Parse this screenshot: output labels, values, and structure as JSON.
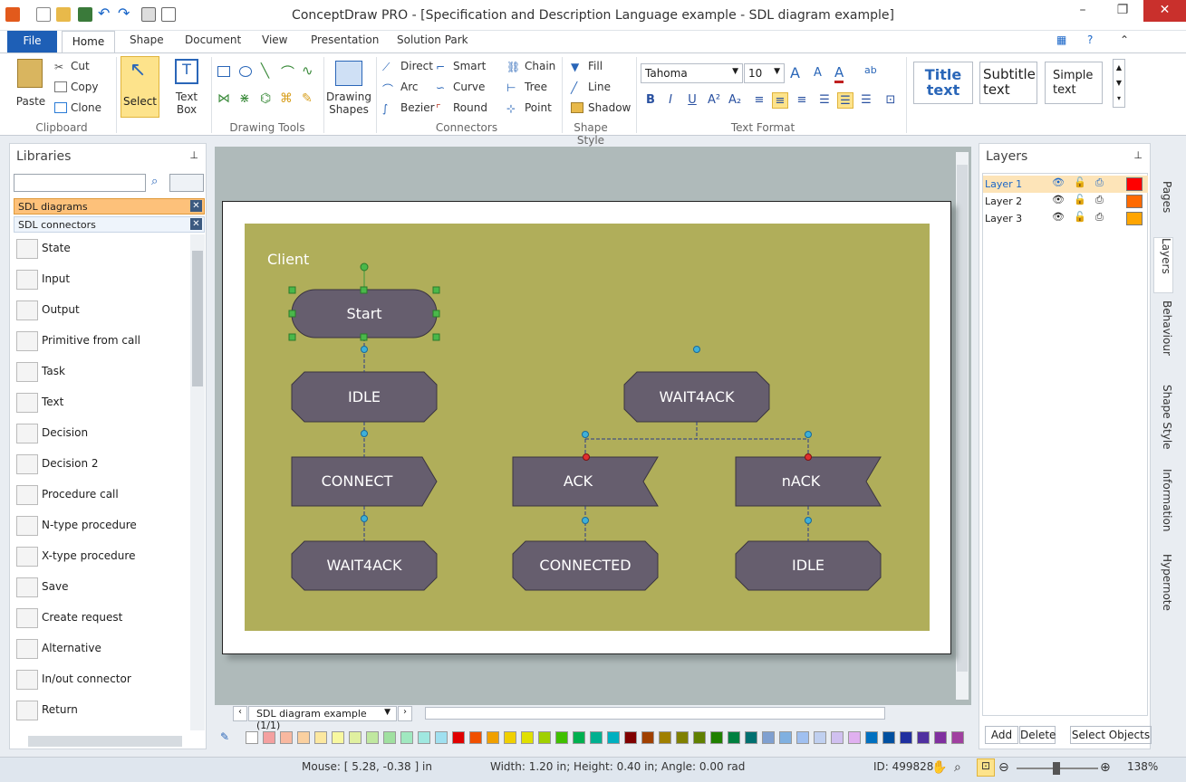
{
  "app": {
    "title": "ConceptDraw PRO - [Specification and Description Language example - SDL diagram example]"
  },
  "menu_tabs": [
    "File",
    "Home",
    "Shape",
    "Document",
    "View",
    "Presentation",
    "Solution Park"
  ],
  "ribbon": {
    "clipboard": {
      "paste": "Paste",
      "cut": "Cut",
      "copy": "Copy",
      "clone": "Clone",
      "label": "Clipboard"
    },
    "select": "Select",
    "text_box": [
      "Text",
      "Box"
    ],
    "drawing_tools_label": "Drawing Tools",
    "drawing_shapes": [
      "Drawing",
      "Shapes"
    ],
    "connectors": {
      "direct": "Direct",
      "arc": "Arc",
      "bezier": "Bezier",
      "smart": "Smart",
      "curve": "Curve",
      "round": "Round",
      "chain": "Chain",
      "tree": "Tree",
      "point": "Point",
      "label": "Connectors"
    },
    "shape_style": {
      "fill": "Fill",
      "line": "Line",
      "shadow": "Shadow",
      "label": "Shape Style"
    },
    "text_format": {
      "font": "Tahoma",
      "size": "10",
      "label": "Text Format",
      "bold": "B",
      "italic": "I",
      "underline": "U"
    },
    "styles": {
      "title": [
        "Title",
        "text"
      ],
      "subtitle": [
        "Subtitle",
        "text"
      ],
      "simple": [
        "Simple",
        "text"
      ]
    }
  },
  "libraries": {
    "title": "Libraries",
    "search_value": "",
    "open": [
      "SDL diagrams",
      "SDL connectors"
    ],
    "items": [
      "State",
      "Input",
      "Output",
      "Primitive from call",
      "Task",
      "Text",
      "Decision",
      "Decision 2",
      "Procedure call",
      "N-type procedure",
      "X-type procedure",
      "Save",
      "Create request",
      "Alternative",
      "In/out connector",
      "Return"
    ]
  },
  "diagram": {
    "lane_title": "Client",
    "shapes": [
      "Start",
      "IDLE",
      "CONNECT",
      "WAIT4ACK",
      "WAIT4ACK",
      "ACK",
      "nACK",
      "CONNECTED",
      "IDLE"
    ],
    "fill_color": "#665e6e",
    "bg_color": "#b0ae5a"
  },
  "page_nav": {
    "current": "SDL diagram example (1/1)"
  },
  "layers": {
    "title": "Layers",
    "rows": [
      {
        "name": "Layer 1",
        "color": "#ff0000"
      },
      {
        "name": "Layer 2",
        "color": "#ff6a00"
      },
      {
        "name": "Layer 3",
        "color": "#ffa500"
      }
    ],
    "buttons": {
      "add": "Add",
      "delete": "Delete",
      "select": "Select Objects"
    }
  },
  "side_tabs": [
    "Pages",
    "Layers",
    "Behaviour",
    "Shape Style",
    "Information",
    "Hypernote"
  ],
  "status": {
    "mouse": "Mouse: [ 5.28, -0.38 ] in",
    "size": "Width: 1.20 in;  Height: 0.40 in;  Angle: 0.00 rad",
    "id": "ID: 499828",
    "zoom": "138%"
  }
}
